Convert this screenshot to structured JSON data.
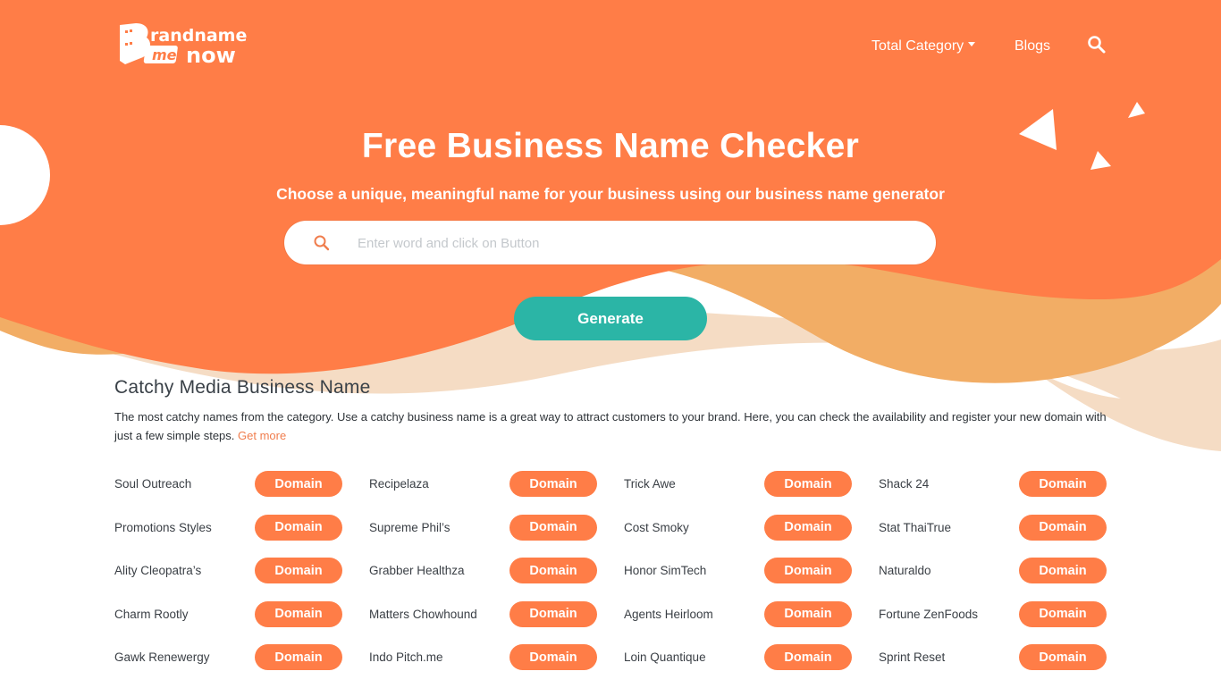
{
  "brand": {
    "logo_text_line1": "randname",
    "logo_letter": "B",
    "logo_badge": "me",
    "logo_text_line2": "now"
  },
  "colors": {
    "primary_orange": "#ff7d47",
    "light_orange": "#f2ad65",
    "peach": "#f5dcc4",
    "teal": "#2bb5a6",
    "link": "#f07d4d"
  },
  "nav": {
    "total_category": "Total Category",
    "blogs": "Blogs",
    "search_icon": "search-icon"
  },
  "hero": {
    "title": "Free Business Name Checker",
    "subtitle": "Choose a unique, meaningful name for your business using our business name generator",
    "search_placeholder": "Enter word and click on Button",
    "search_value": "",
    "generate_label": "Generate"
  },
  "section": {
    "title": "Catchy Media Business Name",
    "description": "The most catchy names from the category. Use a catchy business name is a great way to attract customers to your brand. Here, you can check the availability and register your new domain with just a few simple steps.",
    "get_more": "Get more"
  },
  "domain_button_label": "Domain",
  "names": [
    "Soul Outreach",
    "Recipelaza",
    "Trick Awe",
    "Shack 24",
    "Promotions Styles",
    "Supreme Phil’s",
    "Cost Smoky",
    "Stat ThaiTrue",
    "Ality Cleopatra’s",
    "Grabber Healthza",
    "Honor SimTech",
    "Naturaldo",
    "Charm Rootly",
    "Matters Chowhound",
    "Agents Heirloom",
    "Fortune ZenFoods",
    "Gawk Renewergy",
    "Indo Pitch.me",
    "Loin Quantique",
    "Sprint Reset"
  ]
}
